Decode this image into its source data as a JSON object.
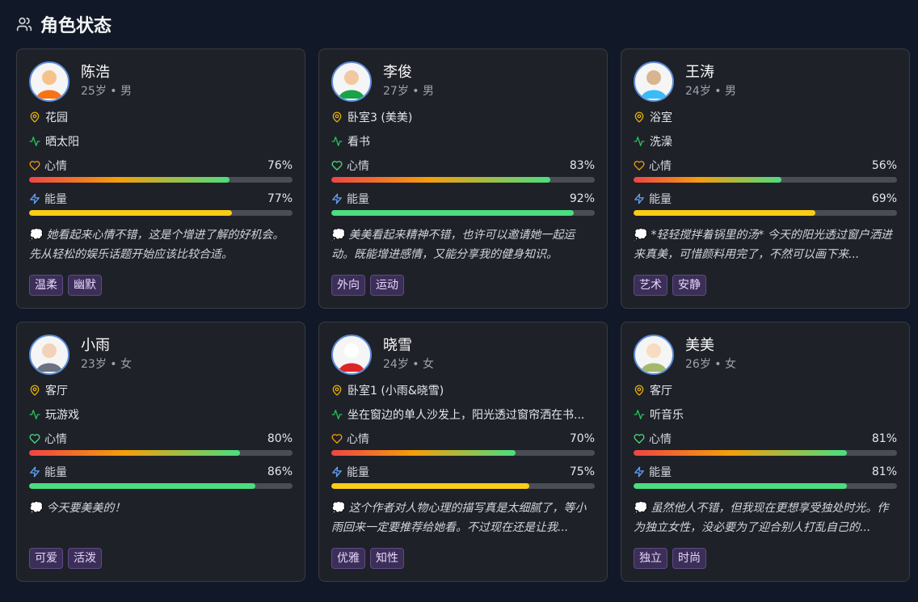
{
  "header": {
    "title": "角色状态",
    "icon": "users-icon"
  },
  "colors": {
    "accent_location": "#eab308",
    "accent_activity": "#22c55e",
    "tag_bg": "#3b2f57"
  },
  "labels": {
    "mood": "心情",
    "energy": "能量"
  },
  "characters": [
    {
      "name": "陈浩",
      "meta": "25岁 • 男",
      "location": "花园",
      "activity": "晒太阳",
      "mood": 76,
      "mood_text": "76%",
      "energy": 77,
      "energy_text": "77%",
      "energy_color": "yellow",
      "thought": "她看起来心情不错，这是个增进了解的好机会。先从轻松的娱乐话题开始应该比较合适。",
      "tags": [
        "温柔",
        "幽默"
      ]
    },
    {
      "name": "李俊",
      "meta": "27岁 • 男",
      "location": "卧室3 (美美)",
      "activity": "看书",
      "mood": 83,
      "mood_text": "83%",
      "energy": 92,
      "energy_text": "92%",
      "energy_color": "green",
      "thought": "美美看起来精神不错，也许可以邀请她一起运动。既能增进感情，又能分享我的健身知识。",
      "tags": [
        "外向",
        "运动"
      ]
    },
    {
      "name": "王涛",
      "meta": "24岁 • 男",
      "location": "浴室",
      "activity": "洗澡",
      "mood": 56,
      "mood_text": "56%",
      "energy": 69,
      "energy_text": "69%",
      "energy_color": "yellow",
      "thought": "*轻轻搅拌着锅里的汤* 今天的阳光透过窗户洒进来真美，可惜颜料用完了，不然可以画下来...",
      "tags": [
        "艺术",
        "安静"
      ]
    },
    {
      "name": "小雨",
      "meta": "23岁 • 女",
      "location": "客厅",
      "activity": "玩游戏",
      "mood": 80,
      "mood_text": "80%",
      "energy": 86,
      "energy_text": "86%",
      "energy_color": "green",
      "thought": "今天要美美的！",
      "tags": [
        "可爱",
        "活泼"
      ]
    },
    {
      "name": "晓雪",
      "meta": "24岁 • 女",
      "location": "卧室1 (小雨&晓雪)",
      "activity": "坐在窗边的单人沙发上，阳光透过窗帘洒在书...",
      "mood": 70,
      "mood_text": "70%",
      "energy": 75,
      "energy_text": "75%",
      "energy_color": "yellow",
      "thought": "这个作者对人物心理的描写真是太细腻了，等小雨回来一定要推荐给她看。不过现在还是让我...",
      "tags": [
        "优雅",
        "知性"
      ]
    },
    {
      "name": "美美",
      "meta": "26岁 • 女",
      "location": "客厅",
      "activity": "听音乐",
      "mood": 81,
      "mood_text": "81%",
      "energy": 81,
      "energy_text": "81%",
      "energy_color": "green",
      "thought": "虽然他人不错，但我现在更想享受独处时光。作为独立女性，没必要为了迎合别人打乱自己的...",
      "tags": [
        "独立",
        "时尚"
      ]
    }
  ]
}
